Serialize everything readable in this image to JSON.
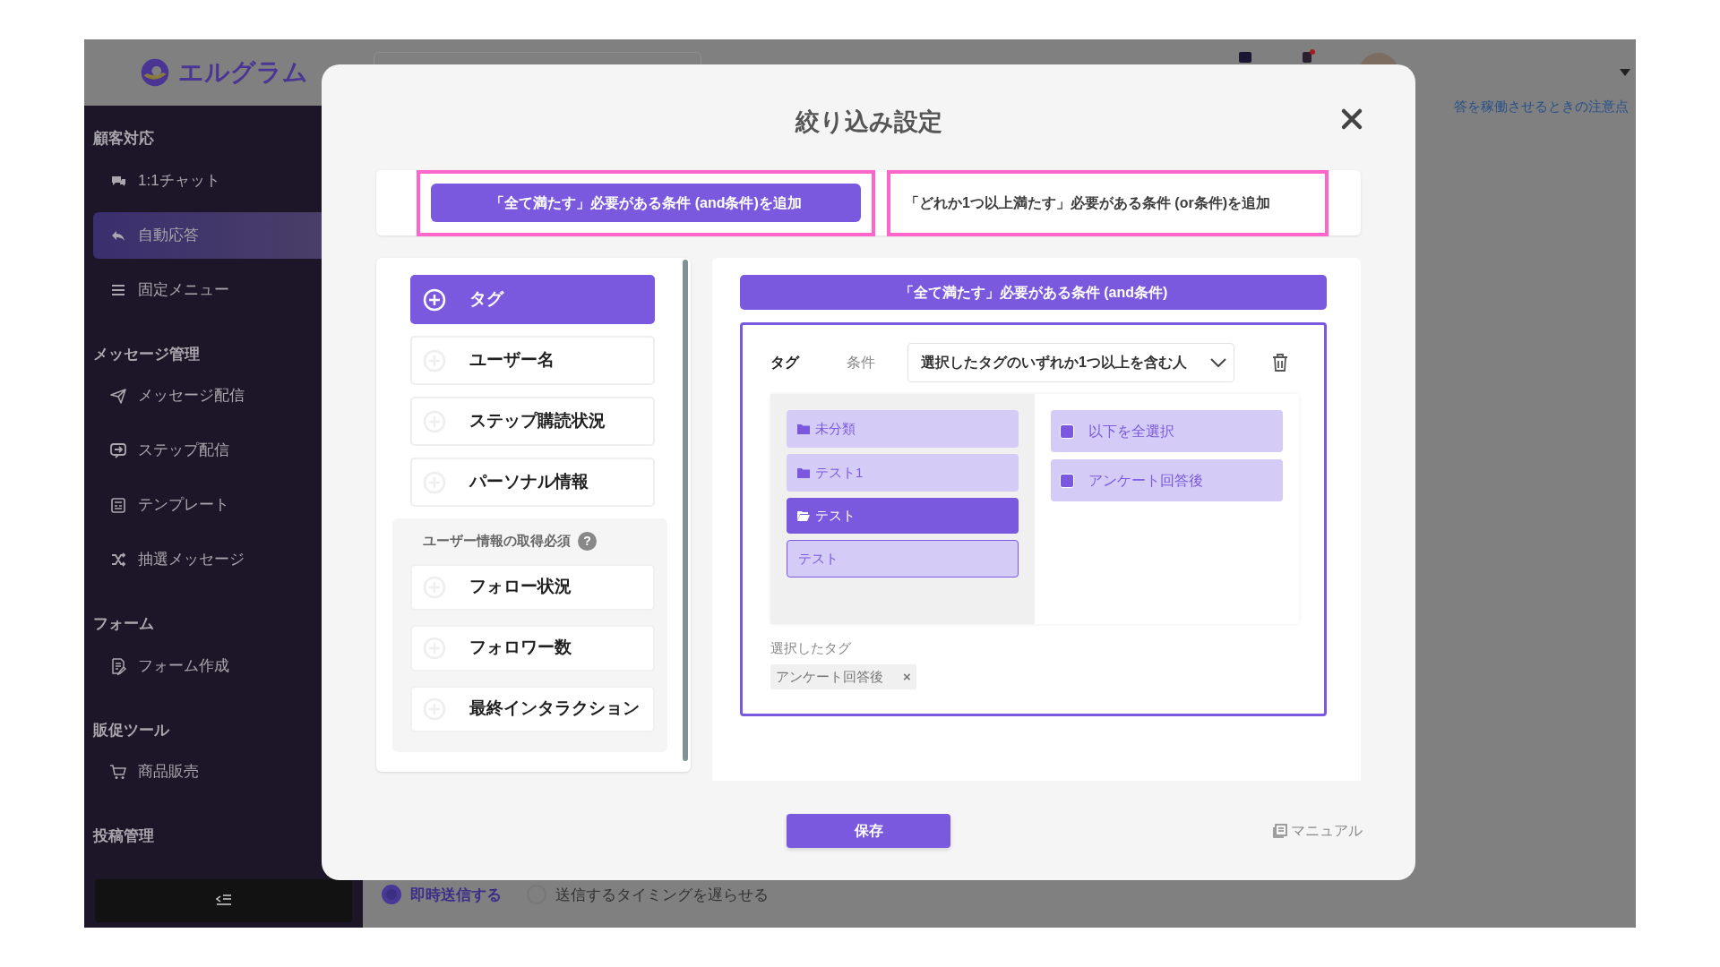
{
  "header": {
    "logo": "エルグラム"
  },
  "sidebar": {
    "sections": [
      {
        "title": "顧客対応",
        "items": [
          {
            "label": "1:1チャット",
            "selected": false
          },
          {
            "label": "自動応答",
            "selected": true
          },
          {
            "label": "固定メニュー",
            "selected": false
          }
        ]
      },
      {
        "title": "メッセージ管理",
        "items": [
          {
            "label": "メッセージ配信",
            "selected": false
          },
          {
            "label": "ステップ配信",
            "selected": false
          },
          {
            "label": "テンプレート",
            "selected": false
          },
          {
            "label": "抽選メッセージ",
            "selected": false
          }
        ]
      },
      {
        "title": "フォーム",
        "items": [
          {
            "label": "フォーム作成",
            "selected": false
          }
        ]
      },
      {
        "title": "販促ツール",
        "items": [
          {
            "label": "商品販売",
            "selected": false
          }
        ]
      },
      {
        "title": "投稿管理"
      }
    ]
  },
  "page": {
    "notice_link": "答を稼働させるときの注意点",
    "radios": [
      {
        "label": "即時送信する",
        "selected": true
      },
      {
        "label": "送信するタイミングを遅らせる",
        "selected": false
      }
    ]
  },
  "modal": {
    "title": "絞り込み設定",
    "add_buttons": [
      {
        "label": "「全て満たす」必要がある条件 (and条件)を追加",
        "selected": true,
        "highlighted": true
      },
      {
        "label": "「どれか1つ以上満たす」必要がある条件 (or条件)を追加",
        "selected": false,
        "highlighted": true
      }
    ],
    "categories": [
      {
        "label": "タグ",
        "selected": true
      },
      {
        "label": "ユーザー名",
        "selected": false
      },
      {
        "label": "ステップ購読状況",
        "selected": false
      },
      {
        "label": "パーソナル情報",
        "selected": false
      }
    ],
    "required_group": {
      "title": "ユーザー情報の取得必須",
      "help": "?",
      "items": [
        {
          "label": "フォロー状況",
          "selected": false
        },
        {
          "label": "フォロワー数",
          "selected": false
        },
        {
          "label": "最終インタラクション",
          "selected": false
        }
      ]
    },
    "condition": {
      "header": "「全て満たす」必要がある条件 (and条件)",
      "field": "タグ",
      "condition_label": "条件",
      "select_value": "選択したタグのいずれか1つ以上を含む人",
      "folders": [
        {
          "label": "未分類",
          "kind": "folder",
          "selected": false
        },
        {
          "label": "テスト1",
          "kind": "folder",
          "selected": false
        },
        {
          "label": "テスト",
          "kind": "folder",
          "selected": true
        },
        {
          "label": "テスト",
          "kind": "entry",
          "selected": false
        }
      ],
      "tags": [
        {
          "label": "以下を全選択",
          "checked": false
        },
        {
          "label": "アンケート回答後",
          "checked": false
        }
      ],
      "selected_label": "選択したタグ",
      "chips": [
        {
          "label": "アンケート回答後",
          "remove": "×"
        }
      ]
    },
    "save": "保存",
    "manual": "マニュアル"
  }
}
